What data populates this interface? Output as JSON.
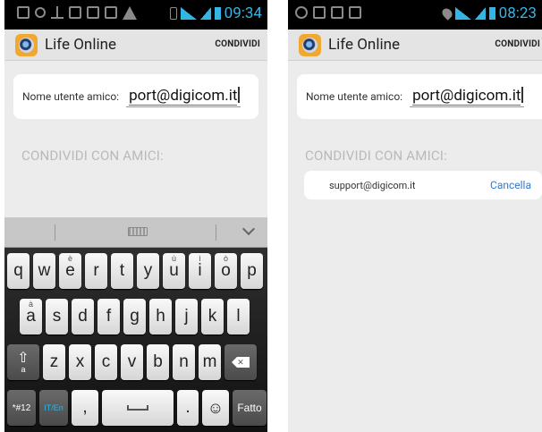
{
  "left": {
    "status": {
      "time": "09:34"
    },
    "actionbar": {
      "title": "Life Online",
      "action": "CONDIVIDI"
    },
    "input": {
      "label": "Nome utente amico:",
      "value": "port@digicom.it"
    },
    "section": "CONDIVIDI CON AMICI:",
    "keyboard": {
      "row1": [
        {
          "k": "q",
          "alt": ""
        },
        {
          "k": "w",
          "alt": ""
        },
        {
          "k": "e",
          "alt": "è"
        },
        {
          "k": "r",
          "alt": ""
        },
        {
          "k": "t",
          "alt": ""
        },
        {
          "k": "y",
          "alt": ""
        },
        {
          "k": "u",
          "alt": "ù"
        },
        {
          "k": "i",
          "alt": "ì"
        },
        {
          "k": "o",
          "alt": "ò"
        },
        {
          "k": "p",
          "alt": ""
        }
      ],
      "row2": [
        {
          "k": "a",
          "alt": "à"
        },
        {
          "k": "s",
          "alt": ""
        },
        {
          "k": "d",
          "alt": ""
        },
        {
          "k": "f",
          "alt": ""
        },
        {
          "k": "g",
          "alt": ""
        },
        {
          "k": "h",
          "alt": ""
        },
        {
          "k": "j",
          "alt": ""
        },
        {
          "k": "k",
          "alt": ""
        },
        {
          "k": "l",
          "alt": ""
        }
      ],
      "row3": [
        "z",
        "x",
        "c",
        "v",
        "b",
        "n",
        "m"
      ],
      "shift_sub": "a",
      "sym": "*#12",
      "lang": "IT/En",
      "comma": ",",
      "dot": ".",
      "done": "Fatto"
    }
  },
  "right": {
    "status": {
      "time": "08:23"
    },
    "actionbar": {
      "title": "Life Online",
      "action": "CONDIVIDI"
    },
    "input": {
      "label": "Nome utente amico:",
      "value": "port@digicom.it"
    },
    "section": "CONDIVIDI CON AMICI:",
    "friend": {
      "name": "support@digicom.it",
      "cancel": "Cancella"
    }
  },
  "colors": {
    "accent": "#33b5e5",
    "link": "#2d7bd8",
    "background": "#ececec"
  }
}
